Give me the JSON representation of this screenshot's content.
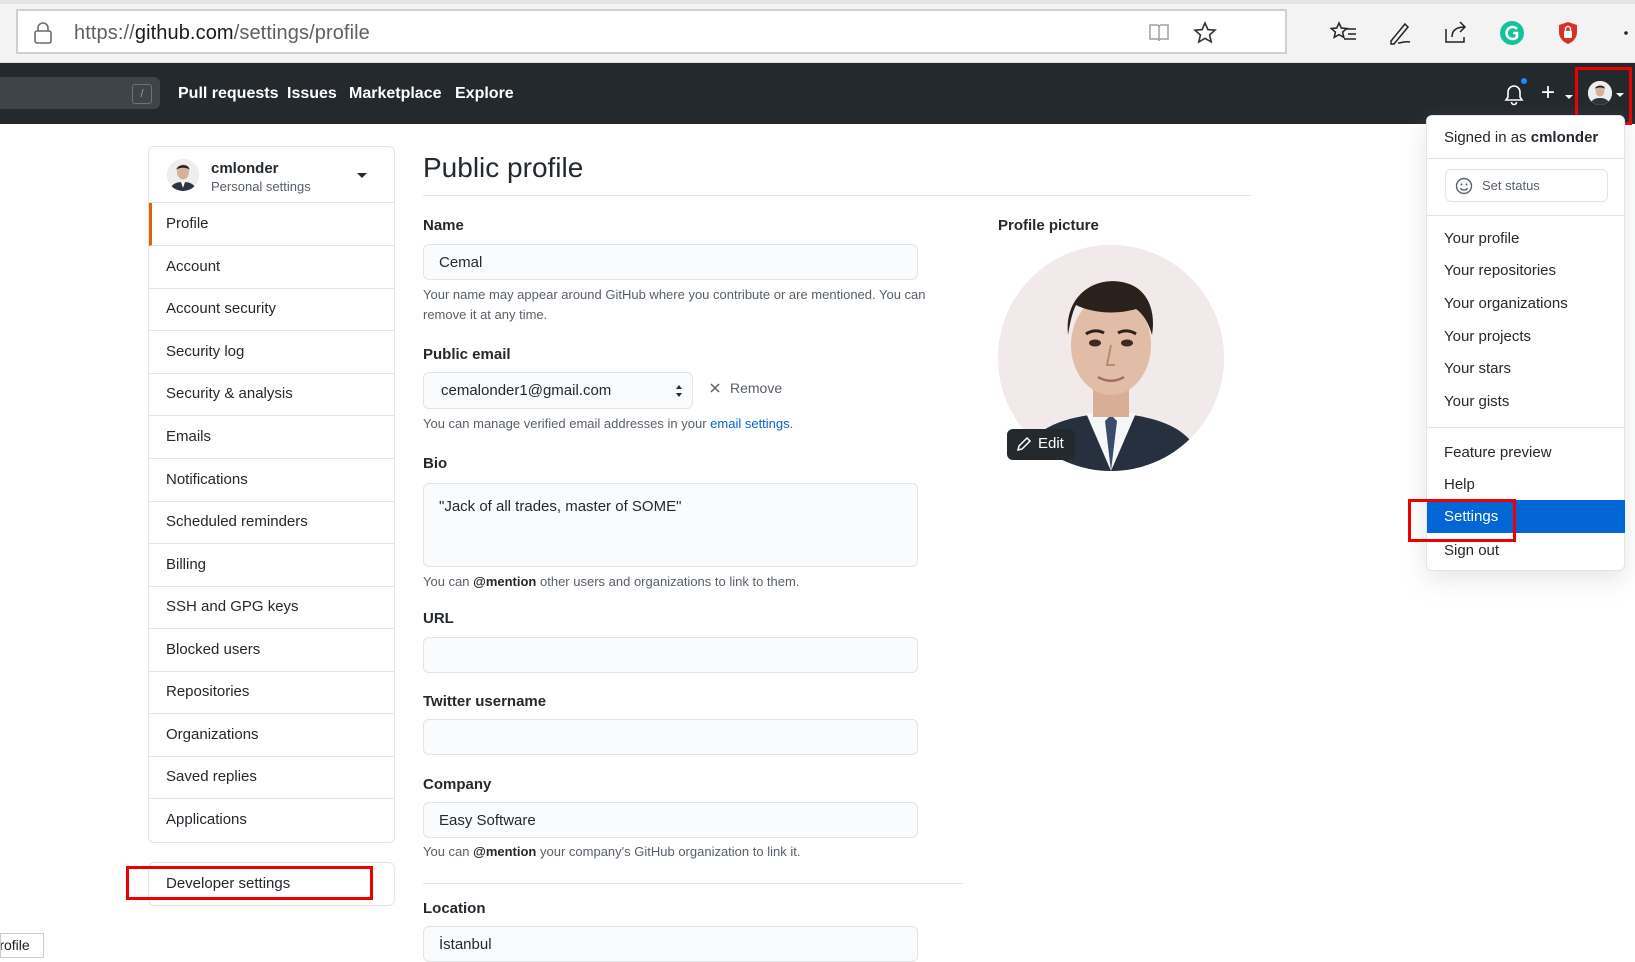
{
  "browser": {
    "url_scheme": "https://",
    "url_host": "github.com",
    "url_path": "/settings/profile"
  },
  "header": {
    "search_key": "/",
    "nav": [
      "Pull requests",
      "Issues",
      "Marketplace",
      "Explore"
    ],
    "plus": "+"
  },
  "sidebar": {
    "username": "cmlonder",
    "subtitle": "Personal settings",
    "items": [
      "Profile",
      "Account",
      "Account security",
      "Security log",
      "Security & analysis",
      "Emails",
      "Notifications",
      "Scheduled reminders",
      "Billing",
      "SSH and GPG keys",
      "Blocked users",
      "Repositories",
      "Organizations",
      "Saved replies",
      "Applications"
    ],
    "developer": "Developer settings"
  },
  "main": {
    "title": "Public profile",
    "name_label": "Name",
    "name_value": "Cemal",
    "name_note": "Your name may appear around GitHub where you contribute or are mentioned. You can remove it at any time.",
    "email_label": "Public email",
    "email_value": "cemalonder1@gmail.com",
    "remove": "Remove",
    "email_note_pre": "You can manage verified email addresses in your",
    "email_note_link": "email settings",
    "email_note_post": ".",
    "bio_label": "Bio",
    "bio_value": "\"Jack of all trades, master of SOME\"",
    "bio_note_pre": "You can",
    "bio_note_bold": "@mention",
    "bio_note_post": "other users and organizations to link to them.",
    "url_label": "URL",
    "url_value": "",
    "twitter_label": "Twitter username",
    "twitter_value": "",
    "company_label": "Company",
    "company_value": "Easy Software",
    "company_note_pre": "You can",
    "company_note_bold": "@mention",
    "company_note_post": "your company's GitHub organization to link it.",
    "location_label": "Location",
    "location_value": "İstanbul",
    "picture_label": "Profile picture",
    "edit": "Edit"
  },
  "dropdown": {
    "signed_pre": "Signed in as",
    "signed_user": "cmlonder",
    "set_status": "Set status",
    "group1": [
      "Your profile",
      "Your repositories",
      "Your organizations",
      "Your projects",
      "Your stars",
      "Your gists"
    ],
    "group2": [
      "Feature preview",
      "Help"
    ],
    "settings": "Settings",
    "signout": "Sign out"
  },
  "tooltip": "Profile",
  "colors": {
    "header_bg": "#24292e",
    "active_accent": "#e36209",
    "selected_bg": "#0366d6",
    "highlight_box": "#ee0000",
    "link": "#0366d6"
  }
}
